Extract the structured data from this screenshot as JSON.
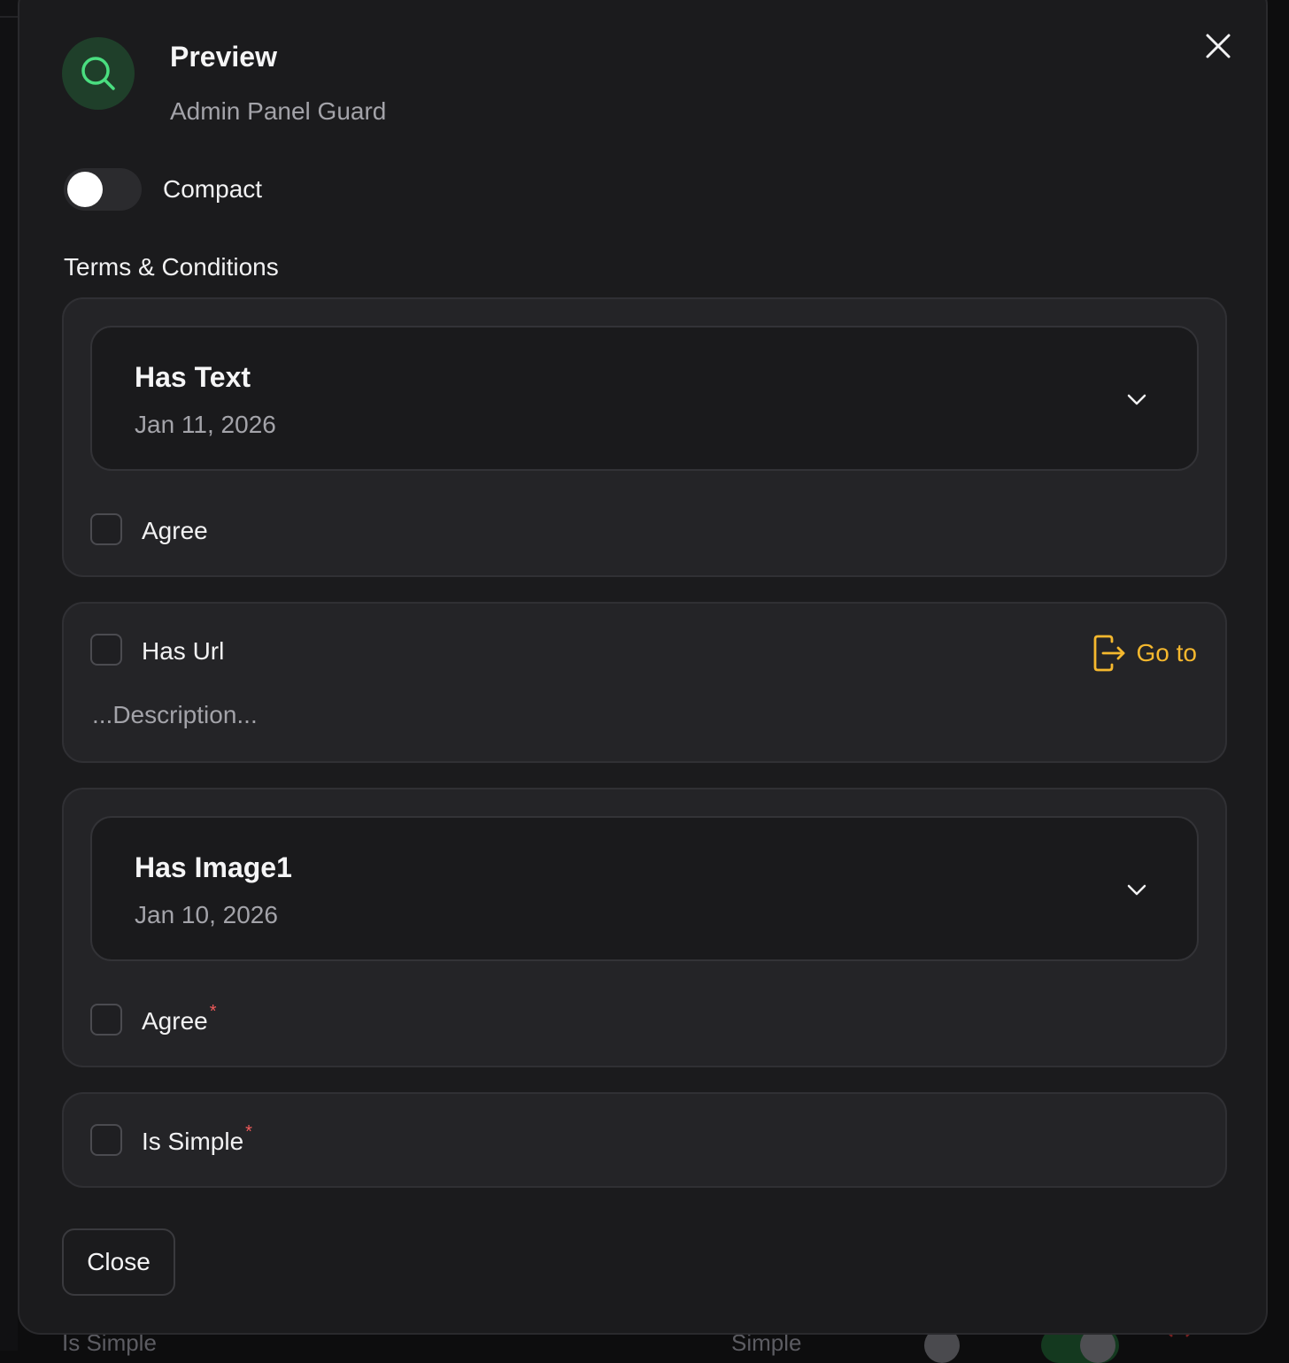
{
  "header": {
    "title": "Preview",
    "subtitle": "Admin Panel Guard",
    "icon": "search-icon",
    "icon_color": "#4ade80",
    "avatar_bg": "#1f3f2a"
  },
  "compact_toggle": {
    "label": "Compact",
    "on": false
  },
  "section": {
    "title": "Terms & Conditions"
  },
  "items": [
    {
      "title": "Has Text",
      "date": "Jan 11, 2026",
      "checkbox_label": "Agree",
      "required": false
    },
    {
      "checkbox_label": "Has Url",
      "link_label": "Go to",
      "description": "...Description...",
      "link_color": "#f5b82e"
    },
    {
      "title": "Has Image1",
      "date": "Jan 10, 2026",
      "checkbox_label": "Agree",
      "required": true
    },
    {
      "checkbox_label": "Is Simple",
      "required": true
    }
  ],
  "required_marker": "*",
  "footer": {
    "close_label": "Close"
  },
  "background": {
    "row_label": "Is Simple",
    "row_value": "Simple"
  }
}
